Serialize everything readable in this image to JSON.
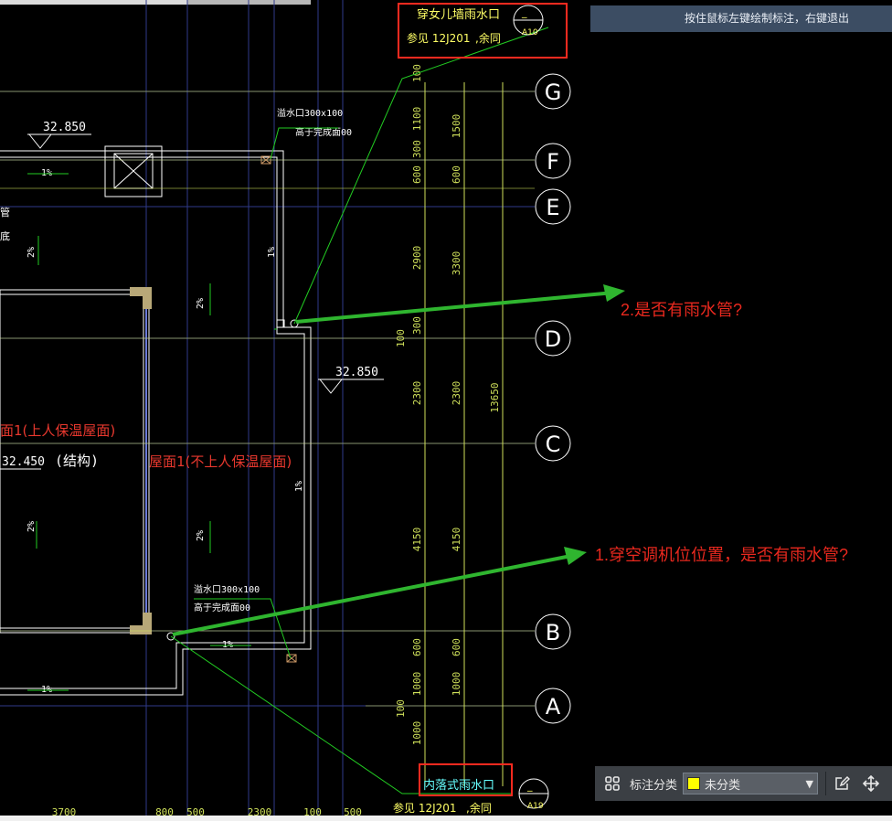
{
  "status_hint": "按住鼠标左键绘制标注，右键退出",
  "annotations": {
    "note_1": "1.穿空调机位位置，是否有雨水管?",
    "note_2": "2.是否有雨水管?"
  },
  "toolbar": {
    "category_label": "标注分类",
    "category_value": "未分类",
    "swatch_color": "#ffff00",
    "grid_icon": "grid-icon",
    "edit_icon": "edit-icon",
    "move_icon": "move-icon"
  },
  "drawing": {
    "callout_top_title": "穿女儿墙雨水口",
    "callout_top_ref": "参见 12J201",
    "callout_top_same": ",余同",
    "callout_top_dash": "_",
    "callout_top_code": "A10",
    "callout_bottom_title": "内落式雨水口",
    "callout_bottom_ref": "参见 12J201",
    "callout_bottom_same": ",余同",
    "callout_bottom_dash": "_",
    "callout_bottom_code": "A19",
    "axis_labels": [
      "G",
      "F",
      "E",
      "D",
      "C",
      "B",
      "A"
    ],
    "elev_1": "32.850",
    "elev_2": "32.850",
    "elev_3": "32.450",
    "structure_note": "(结构)",
    "roof_1": "屋面1(不上人保温屋面)",
    "roof_2": "面1(上人保温屋面)",
    "outlet_1a": "溢水口300x100",
    "outlet_1b": "高于完成面00",
    "outlet_2a": "溢水口300x100",
    "outlet_2b": "高于完成面00",
    "slope": "1%",
    "slope_2": "2%",
    "side_1": "管",
    "side_2": "底",
    "dims_col1": [
      "100",
      "1100",
      "300",
      "600",
      "2900",
      "300",
      "100",
      "2300",
      "4150",
      "600",
      "1000",
      "100",
      "1000"
    ],
    "dims_col2": [
      "1500",
      "600",
      "3300",
      "2300",
      "4150",
      "600",
      "1000"
    ],
    "dim_total": "13650",
    "dims_bottom": [
      "3700",
      "800",
      "500",
      "2300",
      "100",
      "500"
    ]
  }
}
